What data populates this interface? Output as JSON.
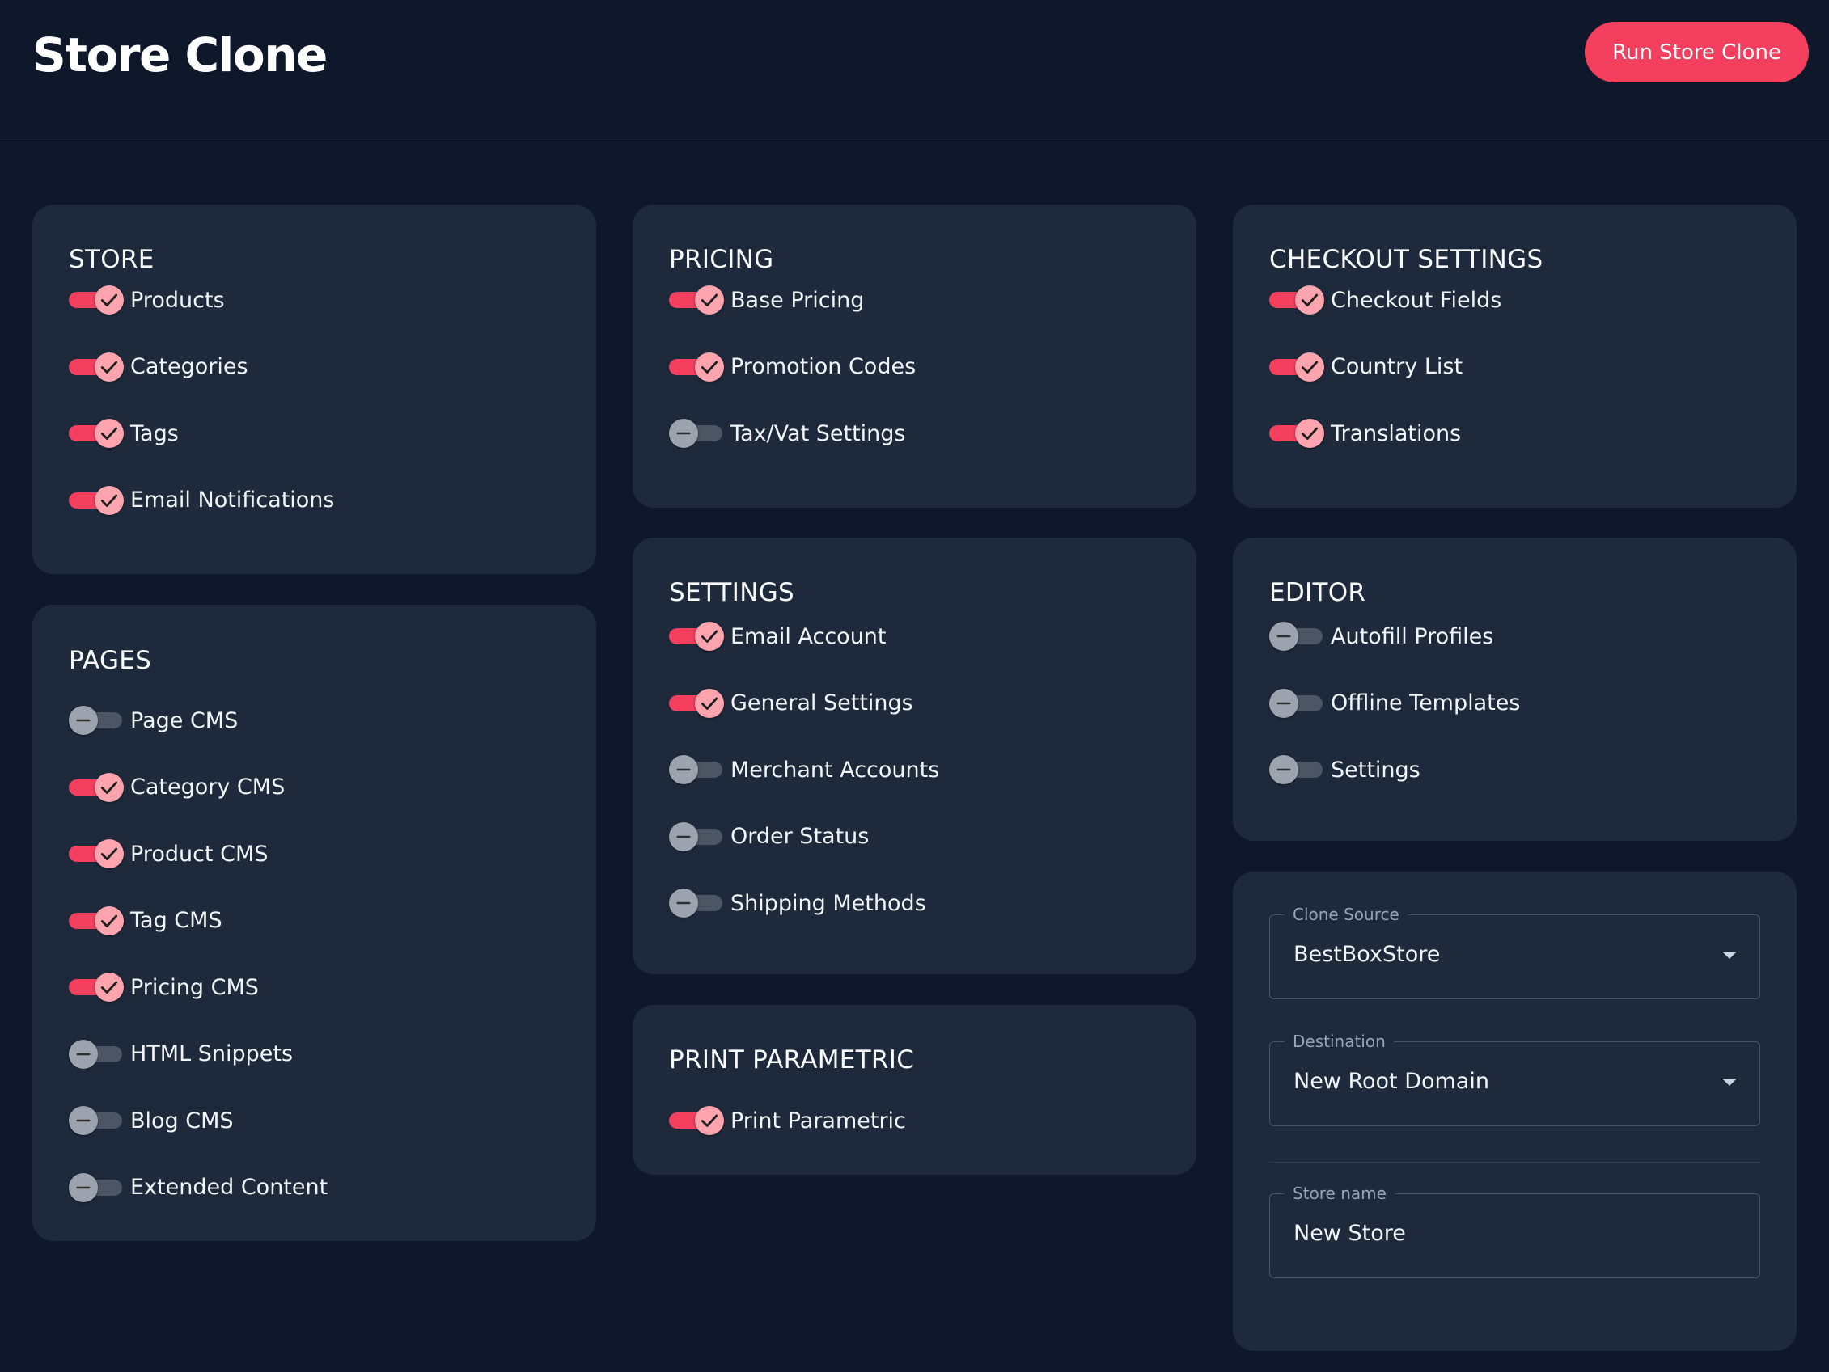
{
  "header": {
    "title": "Store Clone",
    "run_button_label": "Run Store Clone"
  },
  "colors": {
    "background": "#0f172a",
    "card": "#1e293b",
    "accent": "#f43f5e",
    "toggle_on_knob": "#fda4af",
    "toggle_off_track": "#4b5563"
  },
  "icons": {
    "toggle_on": "check-icon",
    "toggle_off": "minus-icon",
    "select": "caret-down-icon"
  },
  "store": {
    "title": "STORE",
    "items": [
      {
        "label": "Products",
        "enabled": true
      },
      {
        "label": "Categories",
        "enabled": true
      },
      {
        "label": "Tags",
        "enabled": true
      },
      {
        "label": "Email Notifications",
        "enabled": true
      }
    ]
  },
  "pages": {
    "title": "PAGES",
    "items": [
      {
        "label": "Page CMS",
        "enabled": false
      },
      {
        "label": "Category CMS",
        "enabled": true
      },
      {
        "label": "Product CMS",
        "enabled": true
      },
      {
        "label": "Tag CMS",
        "enabled": true
      },
      {
        "label": "Pricing CMS",
        "enabled": true
      },
      {
        "label": "HTML Snippets",
        "enabled": false
      },
      {
        "label": "Blog CMS",
        "enabled": false
      },
      {
        "label": "Extended Content",
        "enabled": false
      }
    ]
  },
  "pricing": {
    "title": "PRICING",
    "items": [
      {
        "label": "Base Pricing",
        "enabled": true
      },
      {
        "label": "Promotion Codes",
        "enabled": true
      },
      {
        "label": "Tax/Vat Settings",
        "enabled": false
      }
    ]
  },
  "settings": {
    "title": "SETTINGS",
    "items": [
      {
        "label": "Email Account",
        "enabled": true
      },
      {
        "label": "General Settings",
        "enabled": true
      },
      {
        "label": "Merchant Accounts",
        "enabled": false
      },
      {
        "label": "Order Status",
        "enabled": false
      },
      {
        "label": "Shipping Methods",
        "enabled": false
      }
    ]
  },
  "print_parametric": {
    "title": "PRINT PARAMETRIC",
    "items": [
      {
        "label": "Print Parametric",
        "enabled": true
      }
    ]
  },
  "checkout_settings": {
    "title": "CHECKOUT SETTINGS",
    "items": [
      {
        "label": "Checkout Fields",
        "enabled": true
      },
      {
        "label": "Country List",
        "enabled": true
      },
      {
        "label": "Translations",
        "enabled": true
      }
    ]
  },
  "editor": {
    "title": "EDITOR",
    "items": [
      {
        "label": "Autofill Profiles",
        "enabled": false
      },
      {
        "label": "Offline Templates",
        "enabled": false
      },
      {
        "label": "Settings",
        "enabled": false
      }
    ]
  },
  "clone_form": {
    "clone_source": {
      "label": "Clone Source",
      "value": "BestBoxStore"
    },
    "destination": {
      "label": "Destination",
      "value": "New Root Domain"
    },
    "store_name": {
      "label": "Store name",
      "value": "New Store"
    }
  }
}
